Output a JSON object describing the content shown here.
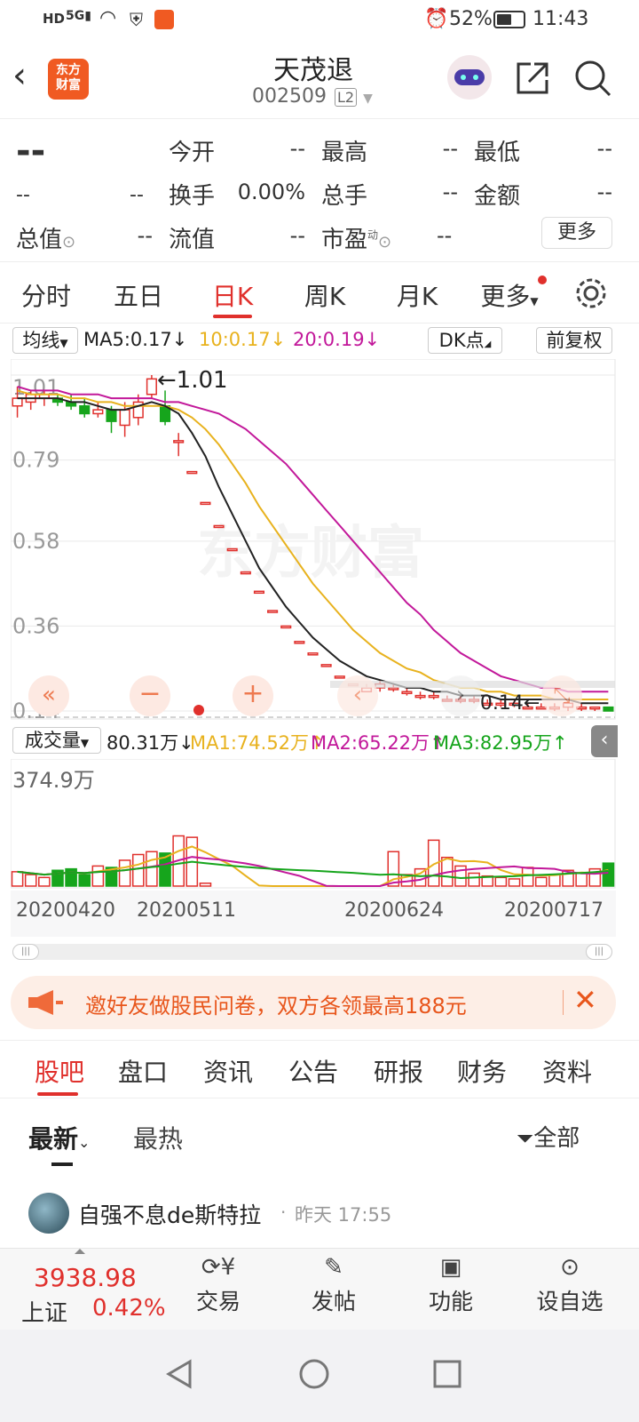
{
  "status": {
    "left_icons": [
      "HD",
      "5G",
      "wifi-icon",
      "shield-icon",
      "app-icon"
    ],
    "alarm": "alarm-icon",
    "battery": "52%",
    "time": "11:43"
  },
  "header": {
    "logo_line1": "东方",
    "logo_line2": "财富",
    "title": "天茂退",
    "code": "002509",
    "level": "L2"
  },
  "quote": {
    "price": "--",
    "change": "--",
    "change_pct": "--",
    "rows": [
      [
        {
          "label": "今开",
          "value": "--"
        },
        {
          "label": "最高",
          "value": "--"
        },
        {
          "label": "最低",
          "value": "--"
        }
      ],
      [
        {
          "label": "换手",
          "value": "0.00%"
        },
        {
          "label": "总手",
          "value": "--"
        },
        {
          "label": "金额",
          "value": "--"
        }
      ],
      [
        {
          "label": "总值",
          "value": "--"
        },
        {
          "label": "流值",
          "value": "--"
        },
        {
          "label": "市盈",
          "value": "--"
        }
      ]
    ],
    "pe_sup": "动",
    "more": "更多"
  },
  "ktabs": [
    "分时",
    "五日",
    "日K",
    "周K",
    "月K",
    "更多"
  ],
  "active_tab": "日K",
  "ma_bar": {
    "selector": "均线",
    "ma5": "MA5:0.17↓",
    "ma10": "10:0.17↓",
    "ma20": "20:0.19↓",
    "dk": "DK点",
    "adjust": "前复权",
    "colors": {
      "ma5": "#222222",
      "ma10": "#e8b21e",
      "ma20": "#c2189a"
    }
  },
  "kline": {
    "y_ticks": [
      "1.01",
      "0.79",
      "0.58",
      "0.36",
      "0.14"
    ],
    "max_label": "←1.01",
    "min_label": "0.14←",
    "watermark": "东方财富",
    "up_color": "#e0302c",
    "down_color": "#16a51c"
  },
  "volume_bar": {
    "selector": "成交量",
    "vol": "80.31万↓",
    "ma1": "MA1:74.52万↑",
    "ma2": "MA2:65.22万↑",
    "ma3": "MA3:82.95万↑",
    "max_label": "374.9万",
    "colors": {
      "ma1": "#e8b21e",
      "ma2": "#c2189a",
      "ma3": "#16a51c"
    }
  },
  "x_dates": [
    "20200420",
    "20200511",
    "20200624",
    "20200717"
  ],
  "chart_data": {
    "type": "candlestick",
    "y_ticks": [
      1.01,
      0.79,
      0.58,
      0.36,
      0.14
    ],
    "ylim": [
      0.14,
      1.01
    ],
    "candles": [
      {
        "o": 0.93,
        "c": 0.95,
        "h": 0.98,
        "l": 0.9
      },
      {
        "o": 0.94,
        "c": 0.96,
        "h": 0.97,
        "l": 0.92
      },
      {
        "o": 0.95,
        "c": 0.96,
        "h": 0.97,
        "l": 0.93
      },
      {
        "o": 0.95,
        "c": 0.94,
        "h": 0.96,
        "l": 0.93
      },
      {
        "o": 0.94,
        "c": 0.93,
        "h": 0.96,
        "l": 0.92
      },
      {
        "o": 0.93,
        "c": 0.91,
        "h": 0.95,
        "l": 0.9
      },
      {
        "o": 0.91,
        "c": 0.92,
        "h": 0.94,
        "l": 0.9
      },
      {
        "o": 0.92,
        "c": 0.89,
        "h": 0.93,
        "l": 0.86
      },
      {
        "o": 0.88,
        "c": 0.92,
        "h": 0.94,
        "l": 0.85
      },
      {
        "o": 0.9,
        "c": 0.94,
        "h": 0.96,
        "l": 0.88
      },
      {
        "o": 0.96,
        "c": 1.0,
        "h": 1.01,
        "l": 0.95
      },
      {
        "o": 0.93,
        "c": 0.89,
        "h": 0.97,
        "l": 0.88
      },
      {
        "o": 0.84,
        "c": 0.84,
        "h": 0.86,
        "l": 0.8
      },
      {
        "o": 0.76,
        "c": 0.76,
        "h": 0.76,
        "l": 0.76
      },
      {
        "o": 0.68,
        "c": 0.68,
        "h": 0.68,
        "l": 0.68
      },
      {
        "o": 0.62,
        "c": 0.62,
        "h": 0.62,
        "l": 0.62
      },
      {
        "o": 0.56,
        "c": 0.56,
        "h": 0.56,
        "l": 0.56
      },
      {
        "o": 0.5,
        "c": 0.5,
        "h": 0.5,
        "l": 0.5
      },
      {
        "o": 0.45,
        "c": 0.45,
        "h": 0.45,
        "l": 0.45
      },
      {
        "o": 0.4,
        "c": 0.4,
        "h": 0.4,
        "l": 0.4
      },
      {
        "o": 0.36,
        "c": 0.36,
        "h": 0.36,
        "l": 0.36
      },
      {
        "o": 0.32,
        "c": 0.32,
        "h": 0.32,
        "l": 0.32
      },
      {
        "o": 0.29,
        "c": 0.29,
        "h": 0.29,
        "l": 0.29
      },
      {
        "o": 0.26,
        "c": 0.26,
        "h": 0.26,
        "l": 0.26
      },
      {
        "o": 0.23,
        "c": 0.23,
        "h": 0.23,
        "l": 0.23
      },
      {
        "o": 0.21,
        "c": 0.21,
        "h": 0.21,
        "l": 0.21
      },
      {
        "o": 0.19,
        "c": 0.2,
        "h": 0.21,
        "l": 0.19
      },
      {
        "o": 0.2,
        "c": 0.21,
        "h": 0.22,
        "l": 0.19
      },
      {
        "o": 0.2,
        "c": 0.2,
        "h": 0.21,
        "l": 0.19
      },
      {
        "o": 0.19,
        "c": 0.19,
        "h": 0.2,
        "l": 0.18
      },
      {
        "o": 0.18,
        "c": 0.18,
        "h": 0.19,
        "l": 0.17
      },
      {
        "o": 0.18,
        "c": 0.18,
        "h": 0.19,
        "l": 0.17
      },
      {
        "o": 0.17,
        "c": 0.17,
        "h": 0.18,
        "l": 0.17
      },
      {
        "o": 0.17,
        "c": 0.17,
        "h": 0.18,
        "l": 0.16
      },
      {
        "o": 0.17,
        "c": 0.17,
        "h": 0.18,
        "l": 0.16
      },
      {
        "o": 0.16,
        "c": 0.16,
        "h": 0.17,
        "l": 0.16
      },
      {
        "o": 0.16,
        "c": 0.16,
        "h": 0.17,
        "l": 0.15
      },
      {
        "o": 0.16,
        "c": 0.16,
        "h": 0.17,
        "l": 0.15
      },
      {
        "o": 0.15,
        "c": 0.15,
        "h": 0.16,
        "l": 0.15
      },
      {
        "o": 0.15,
        "c": 0.15,
        "h": 0.16,
        "l": 0.15
      },
      {
        "o": 0.15,
        "c": 0.15,
        "h": 0.16,
        "l": 0.14
      },
      {
        "o": 0.15,
        "c": 0.16,
        "h": 0.16,
        "l": 0.14
      },
      {
        "o": 0.15,
        "c": 0.15,
        "h": 0.16,
        "l": 0.14
      },
      {
        "o": 0.15,
        "c": 0.15,
        "h": 0.15,
        "l": 0.14
      },
      {
        "o": 0.15,
        "c": 0.14,
        "h": 0.15,
        "l": 0.14
      }
    ],
    "ma5": [
      0.95,
      0.95,
      0.95,
      0.95,
      0.94,
      0.94,
      0.93,
      0.92,
      0.92,
      0.93,
      0.94,
      0.93,
      0.91,
      0.86,
      0.8,
      0.72,
      0.65,
      0.58,
      0.51,
      0.46,
      0.41,
      0.37,
      0.33,
      0.3,
      0.27,
      0.25,
      0.23,
      0.22,
      0.21,
      0.2,
      0.2,
      0.19,
      0.19,
      0.18,
      0.18,
      0.18,
      0.17,
      0.17,
      0.17,
      0.17,
      0.17,
      0.17,
      0.16,
      0.16,
      0.16
    ],
    "ma10": [
      0.97,
      0.96,
      0.96,
      0.96,
      0.95,
      0.95,
      0.94,
      0.94,
      0.93,
      0.93,
      0.93,
      0.93,
      0.92,
      0.9,
      0.87,
      0.83,
      0.78,
      0.73,
      0.67,
      0.62,
      0.57,
      0.52,
      0.47,
      0.43,
      0.39,
      0.35,
      0.32,
      0.29,
      0.27,
      0.25,
      0.24,
      0.22,
      0.21,
      0.2,
      0.2,
      0.19,
      0.19,
      0.18,
      0.18,
      0.18,
      0.17,
      0.17,
      0.17,
      0.17,
      0.17
    ],
    "ma20": [
      0.98,
      0.97,
      0.97,
      0.97,
      0.96,
      0.96,
      0.96,
      0.95,
      0.95,
      0.95,
      0.95,
      0.94,
      0.94,
      0.93,
      0.92,
      0.91,
      0.89,
      0.87,
      0.84,
      0.81,
      0.78,
      0.74,
      0.7,
      0.66,
      0.62,
      0.58,
      0.54,
      0.5,
      0.46,
      0.42,
      0.39,
      0.35,
      0.32,
      0.29,
      0.27,
      0.25,
      0.23,
      0.22,
      0.21,
      0.2,
      0.2,
      0.19,
      0.19,
      0.19,
      0.19
    ],
    "volume_max": 374.9,
    "volume_unit": "万",
    "volumes": [
      50,
      40,
      30,
      55,
      60,
      40,
      70,
      65,
      90,
      110,
      120,
      115,
      175,
      170,
      10,
      0,
      0,
      0,
      0,
      0,
      0,
      0,
      0,
      0,
      0,
      0,
      0,
      0,
      120,
      40,
      60,
      160,
      100,
      70,
      45,
      35,
      30,
      25,
      65,
      30,
      40,
      55,
      45,
      60,
      80
    ],
    "dates": [
      "20200420",
      "20200511",
      "20200624",
      "20200717"
    ]
  },
  "banner": {
    "text": "邀好友做股民问卷，双方各领最高188元"
  },
  "subtabs": [
    "股吧",
    "盘口",
    "资讯",
    "公告",
    "研报",
    "财务",
    "资料"
  ],
  "active_subtab": "股吧",
  "feed": {
    "sort_latest": "最新",
    "sort_hot": "最热",
    "filter": "全部",
    "post_user": "自强不息de斯特拉",
    "post_time": "昨天 17:55"
  },
  "bottom": {
    "index_value": "3938.98",
    "index_name": "上证",
    "index_change": "0.42%",
    "items": [
      "交易",
      "发帖",
      "功能",
      "设自选"
    ]
  }
}
